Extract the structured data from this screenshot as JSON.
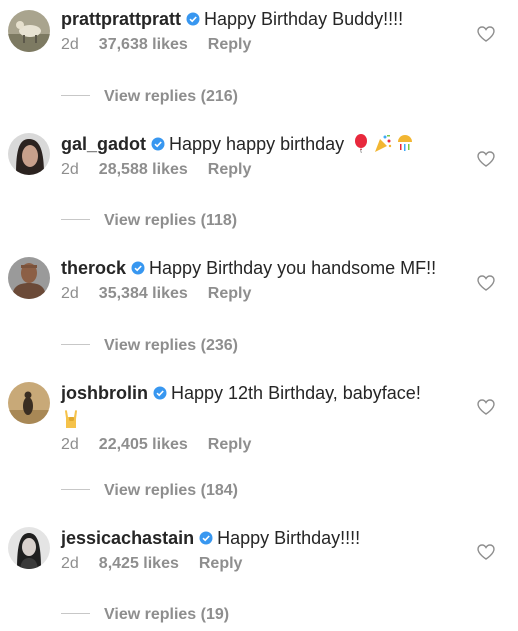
{
  "comments": [
    {
      "username": "prattprattpratt",
      "text": "Happy Birthday Buddy!!!!",
      "age": "2d",
      "likes": "37,638 likes",
      "reply": "Reply",
      "view_replies": "View replies (216)"
    },
    {
      "username": "gal_gadot",
      "text": "Happy happy birthday",
      "emojis": [
        "balloon-emoji",
        "party-popper-emoji",
        "confetti-ball-emoji"
      ],
      "age": "2d",
      "likes": "28,588 likes",
      "reply": "Reply",
      "view_replies": "View replies (118)"
    },
    {
      "username": "therock",
      "text": "Happy Birthday you handsome MF!!",
      "age": "2d",
      "likes": "35,384 likes",
      "reply": "Reply",
      "view_replies": "View replies (236)"
    },
    {
      "username": "joshbrolin",
      "text": "Happy 12th Birthday, babyface!",
      "emojis": [
        "sign-of-the-horns-emoji"
      ],
      "age": "2d",
      "likes": "22,405 likes",
      "reply": "Reply",
      "view_replies": "View replies (184)"
    },
    {
      "username": "jessicachastain",
      "text": "Happy Birthday!!!!",
      "age": "2d",
      "likes": "8,425 likes",
      "reply": "Reply",
      "view_replies": "View replies (19)"
    }
  ],
  "colors": {
    "text": "#262626",
    "secondary": "#8e8e8e",
    "verified": "#3897f0",
    "divider": "#c7c7c7"
  }
}
